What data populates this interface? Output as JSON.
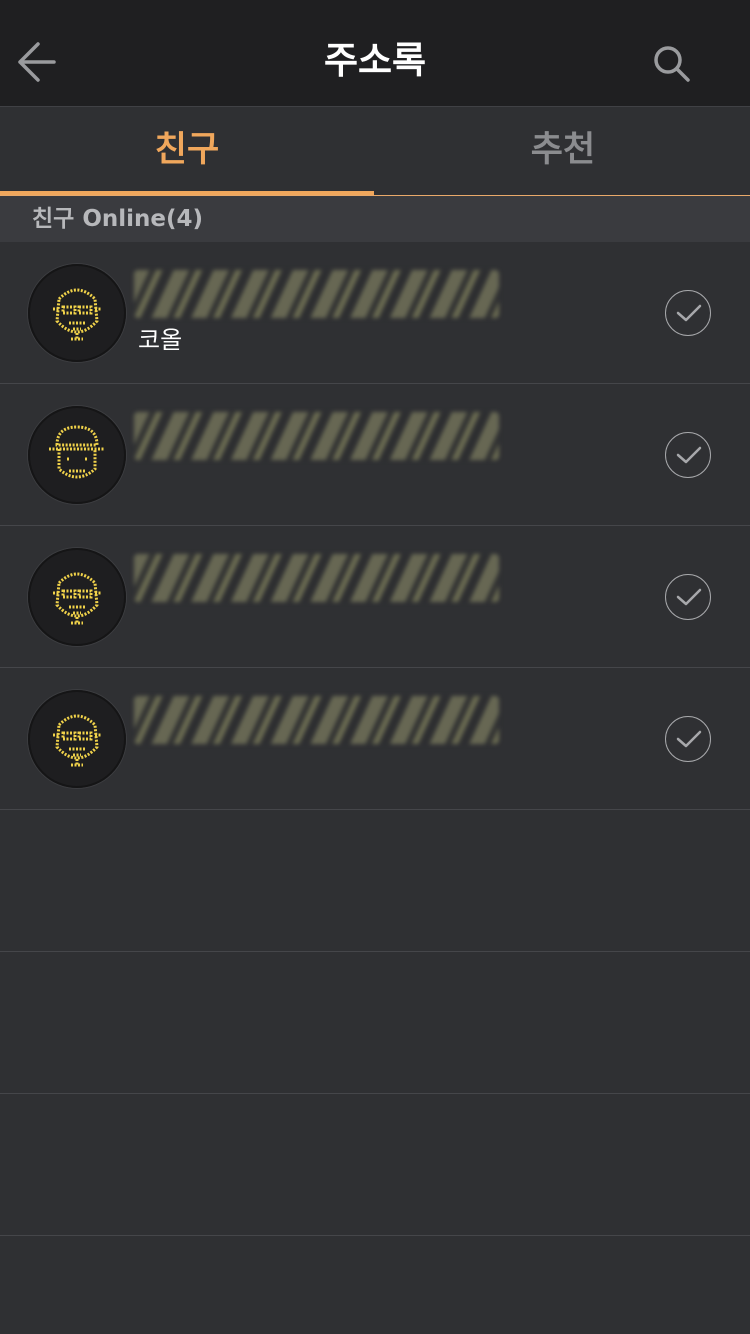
{
  "header": {
    "title": "주소록",
    "back_icon": "arrow-left-icon",
    "search_icon": "search-icon"
  },
  "tabs": [
    {
      "label": "친구",
      "active": true
    },
    {
      "label": "추천",
      "active": false
    }
  ],
  "colors": {
    "accent": "#f0a75c",
    "avatar_face": "#f0d24a"
  },
  "section": {
    "title": "친구 Online(4)"
  },
  "contacts": [
    {
      "status": "코올",
      "avatar": "face-icon"
    },
    {
      "status": "",
      "avatar": "face-cap-icon"
    },
    {
      "status": "",
      "avatar": "face-icon"
    },
    {
      "status": "",
      "avatar": "face-icon"
    }
  ]
}
